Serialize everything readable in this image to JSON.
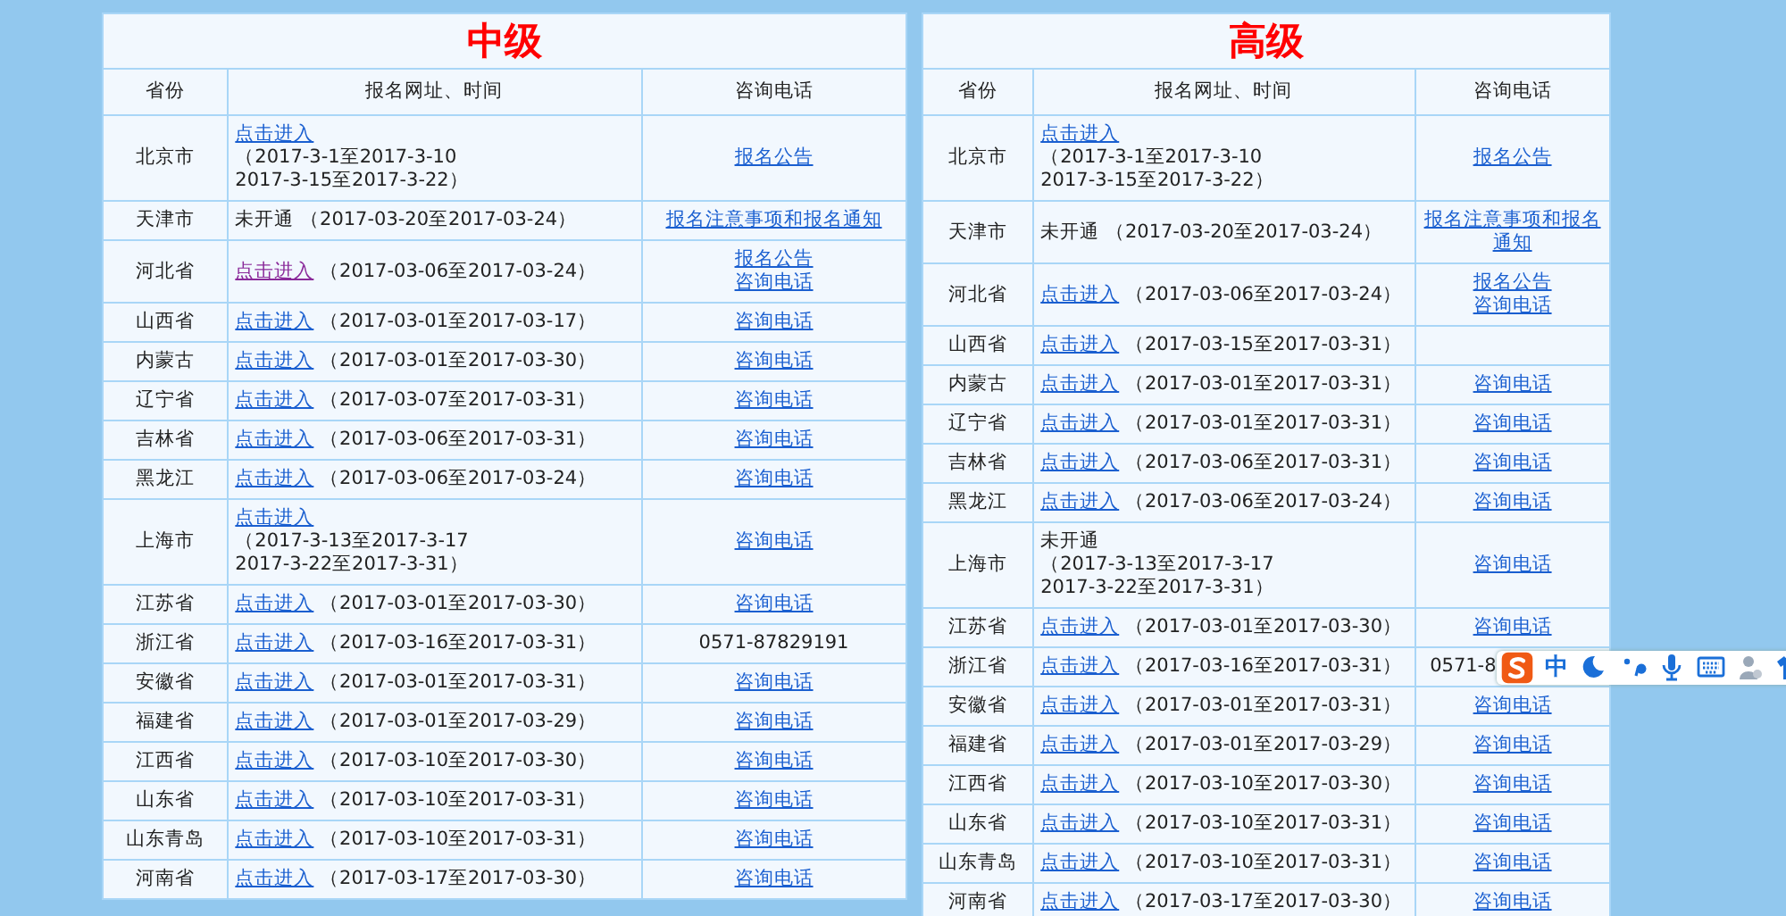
{
  "tables": [
    {
      "title": "中级",
      "columns": [
        "省份",
        "报名网址、时间",
        "咨询电话"
      ],
      "rows": [
        {
          "province": "北京市",
          "signup": {
            "kind": "link",
            "label": "点击进入",
            "visited": false,
            "period": [
              "（2017-3-1至2017-3-10",
              "2017-3-15至2017-3-22）"
            ]
          },
          "contact": [
            {
              "kind": "link",
              "text": "报名公告"
            }
          ]
        },
        {
          "province": "天津市",
          "signup": {
            "kind": "text",
            "label": "未开通",
            "period": [
              "（2017-03-20至2017-03-24）"
            ]
          },
          "contact": [
            {
              "kind": "link",
              "text": "报名注意事项和报名通知"
            }
          ]
        },
        {
          "province": "河北省",
          "signup": {
            "kind": "link",
            "label": "点击进入",
            "visited": true,
            "period": [
              "（2017-03-06至2017-03-24）"
            ]
          },
          "contact": [
            {
              "kind": "link",
              "text": "报名公告"
            },
            {
              "kind": "link",
              "text": "咨询电话"
            }
          ]
        },
        {
          "province": "山西省",
          "signup": {
            "kind": "link",
            "label": "点击进入",
            "visited": false,
            "period": [
              "（2017-03-01至2017-03-17）"
            ]
          },
          "contact": [
            {
              "kind": "link",
              "text": "咨询电话"
            }
          ]
        },
        {
          "province": "内蒙古",
          "signup": {
            "kind": "link",
            "label": "点击进入",
            "visited": false,
            "period": [
              "（2017-03-01至2017-03-30）"
            ]
          },
          "contact": [
            {
              "kind": "link",
              "text": "咨询电话"
            }
          ]
        },
        {
          "province": "辽宁省",
          "signup": {
            "kind": "link",
            "label": "点击进入",
            "visited": false,
            "period": [
              "（2017-03-07至2017-03-31）"
            ]
          },
          "contact": [
            {
              "kind": "link",
              "text": "咨询电话"
            }
          ]
        },
        {
          "province": "吉林省",
          "signup": {
            "kind": "link",
            "label": "点击进入",
            "visited": false,
            "period": [
              "（2017-03-06至2017-03-31）"
            ]
          },
          "contact": [
            {
              "kind": "link",
              "text": "咨询电话"
            }
          ]
        },
        {
          "province": "黑龙江",
          "signup": {
            "kind": "link",
            "label": "点击进入",
            "visited": false,
            "period": [
              "（2017-03-06至2017-03-24）"
            ]
          },
          "contact": [
            {
              "kind": "link",
              "text": "咨询电话"
            }
          ]
        },
        {
          "province": "上海市",
          "signup": {
            "kind": "link",
            "label": "点击进入",
            "visited": false,
            "period": [
              "（2017-3-13至2017-3-17",
              "2017-3-22至2017-3-31）"
            ]
          },
          "contact": [
            {
              "kind": "link",
              "text": "咨询电话"
            }
          ]
        },
        {
          "province": "江苏省",
          "signup": {
            "kind": "link",
            "label": "点击进入",
            "visited": false,
            "period": [
              "（2017-03-01至2017-03-30）"
            ]
          },
          "contact": [
            {
              "kind": "link",
              "text": "咨询电话"
            }
          ]
        },
        {
          "province": "浙江省",
          "signup": {
            "kind": "link",
            "label": "点击进入",
            "visited": false,
            "period": [
              "（2017-03-16至2017-03-31）"
            ]
          },
          "contact": [
            {
              "kind": "text",
              "text": "0571-87829191"
            }
          ]
        },
        {
          "province": "安徽省",
          "signup": {
            "kind": "link",
            "label": "点击进入",
            "visited": false,
            "period": [
              "（2017-03-01至2017-03-31）"
            ]
          },
          "contact": [
            {
              "kind": "link",
              "text": "咨询电话"
            }
          ]
        },
        {
          "province": "福建省",
          "signup": {
            "kind": "link",
            "label": "点击进入",
            "visited": false,
            "period": [
              "（2017-03-01至2017-03-29）"
            ]
          },
          "contact": [
            {
              "kind": "link",
              "text": "咨询电话"
            }
          ]
        },
        {
          "province": "江西省",
          "signup": {
            "kind": "link",
            "label": "点击进入",
            "visited": false,
            "period": [
              "（2017-03-10至2017-03-30）"
            ]
          },
          "contact": [
            {
              "kind": "link",
              "text": "咨询电话"
            }
          ]
        },
        {
          "province": "山东省",
          "signup": {
            "kind": "link",
            "label": "点击进入",
            "visited": false,
            "period": [
              "（2017-03-10至2017-03-31）"
            ]
          },
          "contact": [
            {
              "kind": "link",
              "text": "咨询电话"
            }
          ]
        },
        {
          "province": "山东青岛",
          "signup": {
            "kind": "link",
            "label": "点击进入",
            "visited": false,
            "period": [
              "（2017-03-10至2017-03-31）"
            ]
          },
          "contact": [
            {
              "kind": "link",
              "text": "咨询电话"
            }
          ]
        },
        {
          "province": "河南省",
          "signup": {
            "kind": "link",
            "label": "点击进入",
            "visited": false,
            "period": [
              "（2017-03-17至2017-03-30）"
            ]
          },
          "contact": [
            {
              "kind": "link",
              "text": "咨询电话"
            }
          ]
        }
      ]
    },
    {
      "title": "高级",
      "columns": [
        "省份",
        "报名网址、时间",
        "咨询电话"
      ],
      "rows": [
        {
          "province": "北京市",
          "signup": {
            "kind": "link",
            "label": "点击进入",
            "visited": false,
            "period": [
              "（2017-3-1至2017-3-10",
              "2017-3-15至2017-3-22）"
            ]
          },
          "contact": [
            {
              "kind": "link",
              "text": "报名公告"
            }
          ]
        },
        {
          "province": "天津市",
          "signup": {
            "kind": "text",
            "label": "未开通",
            "period": [
              "（2017-03-20至2017-03-24）"
            ]
          },
          "contact": [
            {
              "kind": "link",
              "text": "报名注意事项和报名通知"
            }
          ]
        },
        {
          "province": "河北省",
          "signup": {
            "kind": "link",
            "label": "点击进入",
            "visited": false,
            "period": [
              "（2017-03-06至2017-03-24）"
            ]
          },
          "contact": [
            {
              "kind": "link",
              "text": "报名公告"
            },
            {
              "kind": "link",
              "text": "咨询电话"
            }
          ]
        },
        {
          "province": "山西省",
          "signup": {
            "kind": "link",
            "label": "点击进入",
            "visited": false,
            "period": [
              "（2017-03-15至2017-03-31）"
            ]
          },
          "contact": []
        },
        {
          "province": "内蒙古",
          "signup": {
            "kind": "link",
            "label": "点击进入",
            "visited": false,
            "period": [
              "（2017-03-01至2017-03-31）"
            ]
          },
          "contact": [
            {
              "kind": "link",
              "text": "咨询电话"
            }
          ]
        },
        {
          "province": "辽宁省",
          "signup": {
            "kind": "link",
            "label": "点击进入",
            "visited": false,
            "period": [
              "（2017-03-01至2017-03-31）"
            ]
          },
          "contact": [
            {
              "kind": "link",
              "text": "咨询电话"
            }
          ]
        },
        {
          "province": "吉林省",
          "signup": {
            "kind": "link",
            "label": "点击进入",
            "visited": false,
            "period": [
              "（2017-03-06至2017-03-31）"
            ]
          },
          "contact": [
            {
              "kind": "link",
              "text": "咨询电话"
            }
          ]
        },
        {
          "province": "黑龙江",
          "signup": {
            "kind": "link",
            "label": "点击进入",
            "visited": false,
            "period": [
              "（2017-03-06至2017-03-24）"
            ]
          },
          "contact": [
            {
              "kind": "link",
              "text": "咨询电话"
            }
          ]
        },
        {
          "province": "上海市",
          "signup": {
            "kind": "text",
            "label": "未开通",
            "period": [
              "（2017-3-13至2017-3-17",
              "2017-3-22至2017-3-31）"
            ]
          },
          "contact": [
            {
              "kind": "link",
              "text": "咨询电话"
            }
          ]
        },
        {
          "province": "江苏省",
          "signup": {
            "kind": "link",
            "label": "点击进入",
            "visited": false,
            "period": [
              "（2017-03-01至2017-03-30）"
            ]
          },
          "contact": [
            {
              "kind": "link",
              "text": "咨询电话"
            }
          ]
        },
        {
          "province": "浙江省",
          "signup": {
            "kind": "link",
            "label": "点击进入",
            "visited": false,
            "period": [
              "（2017-03-16至2017-03-31）"
            ]
          },
          "contact": [
            {
              "kind": "text",
              "text": "0571-8",
              "ime_over": true
            }
          ]
        },
        {
          "province": "安徽省",
          "signup": {
            "kind": "link",
            "label": "点击进入",
            "visited": false,
            "period": [
              "（2017-03-01至2017-03-31）"
            ]
          },
          "contact": [
            {
              "kind": "link",
              "text": "咨询电话"
            }
          ]
        },
        {
          "province": "福建省",
          "signup": {
            "kind": "link",
            "label": "点击进入",
            "visited": false,
            "period": [
              "（2017-03-01至2017-03-29）"
            ]
          },
          "contact": [
            {
              "kind": "link",
              "text": "咨询电话"
            }
          ]
        },
        {
          "province": "江西省",
          "signup": {
            "kind": "link",
            "label": "点击进入",
            "visited": false,
            "period": [
              "（2017-03-10至2017-03-30）"
            ]
          },
          "contact": [
            {
              "kind": "link",
              "text": "咨询电话"
            }
          ]
        },
        {
          "province": "山东省",
          "signup": {
            "kind": "link",
            "label": "点击进入",
            "visited": false,
            "period": [
              "（2017-03-10至2017-03-31）"
            ]
          },
          "contact": [
            {
              "kind": "link",
              "text": "咨询电话"
            }
          ]
        },
        {
          "province": "山东青岛",
          "signup": {
            "kind": "link",
            "label": "点击进入",
            "visited": false,
            "period": [
              "（2017-03-10至2017-03-31）"
            ]
          },
          "contact": [
            {
              "kind": "link",
              "text": "咨询电话"
            }
          ]
        },
        {
          "province": "河南省",
          "signup": {
            "kind": "link",
            "label": "点击进入",
            "visited": false,
            "period": [
              "（2017-03-17至2017-03-30）"
            ]
          },
          "contact": [
            {
              "kind": "link",
              "text": "咨询电话"
            }
          ]
        }
      ]
    }
  ],
  "ime_toolbar": {
    "mode_label": "中"
  }
}
